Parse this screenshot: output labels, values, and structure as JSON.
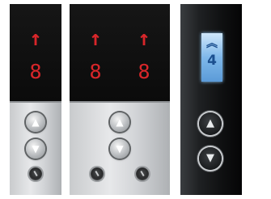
{
  "panels": [
    {
      "id": "panel-a",
      "display": {
        "direction_arrow": "↑",
        "floor": "8"
      },
      "buttons": {
        "up": "▲",
        "down": "▼"
      }
    },
    {
      "id": "panel-b",
      "displays": [
        {
          "direction_arrow": "↑",
          "floor": "8"
        },
        {
          "direction_arrow": "↑",
          "floor": "8"
        }
      ],
      "buttons": {
        "up": "▲",
        "down": "▼"
      }
    },
    {
      "id": "panel-c",
      "display": {
        "direction_arrow": "︽",
        "floor": "4"
      },
      "buttons": {
        "up": "▲",
        "down": "▼"
      }
    }
  ],
  "colors": {
    "led_red": "#d8262a",
    "lcd_blue": "#7fb8ea",
    "steel": "#d3d5d8",
    "dark_panel": "#0e0f10"
  }
}
